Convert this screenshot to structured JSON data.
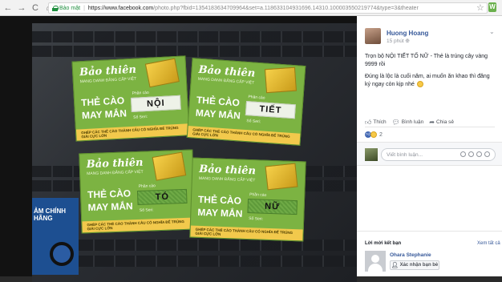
{
  "browser": {
    "nav_back": "←",
    "nav_forward": "→",
    "reload": "C",
    "home": "⌂",
    "secure_label": "Bảo mật",
    "separator": "|",
    "url_host": "https://www.facebook.com",
    "url_path": "/photo.php?fbid=1354183634709964&set=a.118633104931696.14310.100003550219774&type=3&theater",
    "bookmark_icon": "star-icon",
    "extension_icon": "shopping-icon"
  },
  "photo": {
    "sticker_text": "ẢM CHÍNH HÃNG",
    "cards": [
      {
        "brand": "Bảo thiên",
        "brand_sub": "MANG DANH ĐẲNG CẤP VIỆT",
        "line1": "THẺ CÀO",
        "line2": "MAY MẮN",
        "phan": "Phần cào",
        "scratch": "NỘI",
        "serial": "Số Seri:",
        "foot": "GHÉP CÁC THẺ CÀO THÀNH CÂU CÓ NGHĨA ĐỂ TRÚNG GIẢI CỰC LỚN"
      },
      {
        "brand": "Bảo thiên",
        "brand_sub": "MANG DANH ĐẲNG CẤP VIỆT",
        "line1": "THẺ CÀO",
        "line2": "MAY MẮN",
        "phan": "Phần cào",
        "scratch": "TIẾT",
        "serial": "Số Seri:",
        "foot": "GHÉP CÁC THẺ CÀO THÀNH CÂU CÓ NGHĨA ĐỂ TRÚNG GIẢI CỰC LỚN"
      },
      {
        "brand": "Bảo thiên",
        "brand_sub": "MANG DANH ĐẲNG CẤP VIỆT",
        "line1": "THẺ CÀO",
        "line2": "MAY MẮN",
        "phan": "Phần cào",
        "scratch": "TÓ",
        "serial": "Số Seri:",
        "foot": "GHÉP CÁC THẺ CÀO THÀNH CÂU CÓ NGHĨA ĐỂ TRÚNG GIẢI CỰC LỚN"
      },
      {
        "brand": "Bảo thiên",
        "brand_sub": "MANG DANH ĐẲNG CẤP VIỆT",
        "line1": "THẺ CÀO",
        "line2": "MAY MẮN",
        "phan": "Phần cào",
        "scratch": "NỮ",
        "serial": "Số Seri:",
        "foot": "GHÉP CÁC THẺ CÀO THÀNH CÂU CÓ NGHĨA ĐỂ TRÚNG GIẢI CỰC LỚN"
      }
    ]
  },
  "post": {
    "author": "Huong Hoang",
    "time": "15 phút",
    "globe_icon": "globe-icon",
    "menu_icon": "chevron-down-icon",
    "paragraph1": "Trọn bộ NỘI TIẾT TỐ NỮ - Thẻ là trúng cây vàng 9999 rồi",
    "paragraph2": "Đúng là lộc là cuối năm, ai muốn ăn khao thì đăng ký ngay còn kịp nhé",
    "actions": {
      "like": "Thích",
      "comment": "Bình luận",
      "share": "Chia sẻ"
    },
    "reaction_count": "2",
    "comment_placeholder": "Viết bình luận..."
  },
  "suggestions": {
    "title": "Lời mời kết bạn",
    "see_all": "Xem tất cả",
    "person_name": "Ohara Stephanie",
    "add_button": "Xác nhận bạn bè"
  }
}
